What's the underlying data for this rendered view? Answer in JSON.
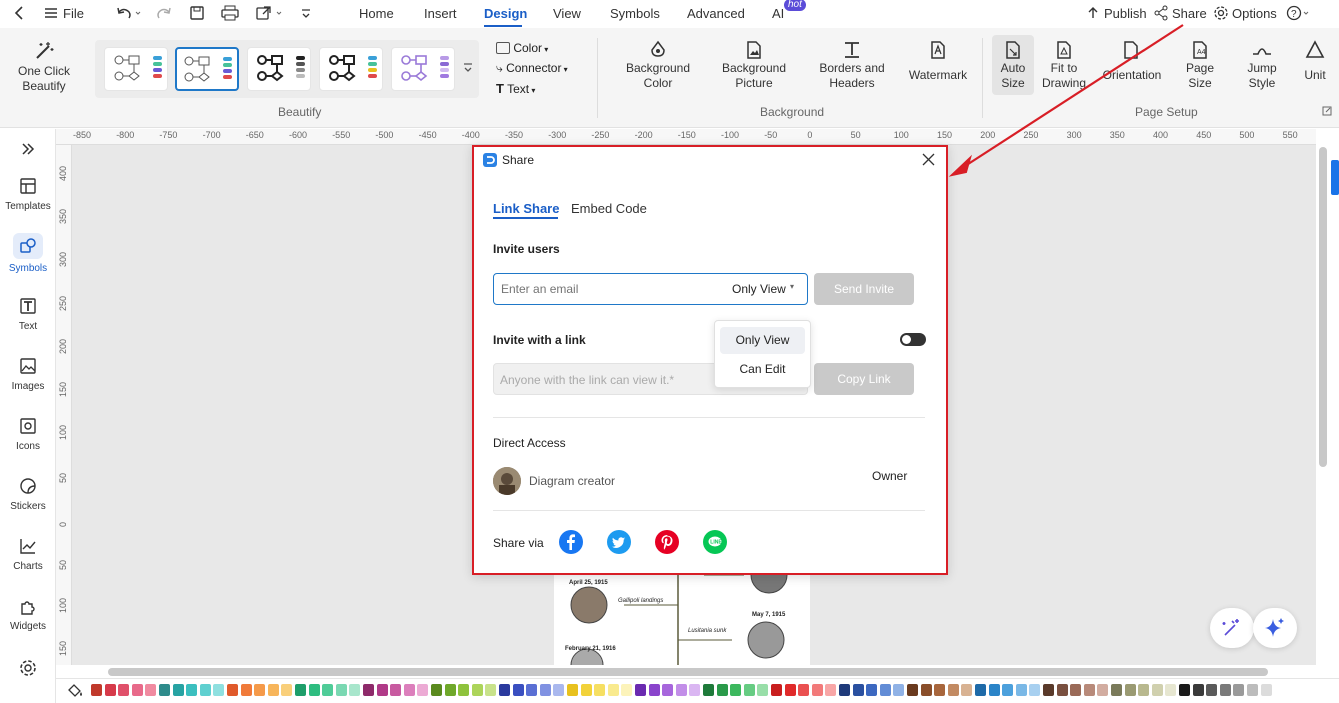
{
  "menubar": {
    "file_label": "File",
    "tabs": [
      "Home",
      "Insert",
      "Design",
      "View",
      "Symbols",
      "Advanced",
      "AI"
    ],
    "active_tab": "Design",
    "hot_badge": "hot",
    "publish_label": "Publish",
    "share_label": "Share",
    "options_label": "Options"
  },
  "ribbon": {
    "one_click_beautify": "One Click Beautify",
    "beautify_group": "Beautify",
    "color_label": "Color",
    "connector_label": "Connector",
    "text_label": "Text",
    "background_color": "Background Color",
    "background_picture": "Background Picture",
    "borders_headers": "Borders and Headers",
    "watermark": "Watermark",
    "background_group": "Background",
    "auto_size": "Auto Size",
    "fit_to_drawing": "Fit to Drawing",
    "orientation": "Orientation",
    "page_size": "Page Size",
    "jump_style": "Jump Style",
    "unit": "Unit",
    "page_setup_group": "Page Setup"
  },
  "sidebar": {
    "items": [
      {
        "label": "Templates",
        "icon": "templates-icon"
      },
      {
        "label": "Symbols",
        "icon": "symbols-icon"
      },
      {
        "label": "Text",
        "icon": "text-icon"
      },
      {
        "label": "Images",
        "icon": "images-icon"
      },
      {
        "label": "Icons",
        "icon": "icons-icon"
      },
      {
        "label": "Stickers",
        "icon": "stickers-icon"
      },
      {
        "label": "Charts",
        "icon": "charts-icon"
      },
      {
        "label": "Widgets",
        "icon": "widgets-icon"
      }
    ],
    "active": "Symbols"
  },
  "ruler": {
    "h_ticks": [
      "-850",
      "-800",
      "-750",
      "-700",
      "-650",
      "-600",
      "-550",
      "-500",
      "-450",
      "-400",
      "-350",
      "-300",
      "-250",
      "-200",
      "-150",
      "-100",
      "-50",
      "0",
      "50",
      "100",
      "150",
      "200",
      "250",
      "300",
      "350",
      "400",
      "450",
      "500",
      "550"
    ],
    "v_ticks": [
      "400",
      "350",
      "300",
      "250",
      "200",
      "150",
      "100",
      "50",
      "0",
      "50",
      "100",
      "150"
    ]
  },
  "share_dialog": {
    "title": "Share",
    "tabs": [
      "Link Share",
      "Embed Code"
    ],
    "active_tab": "Link Share",
    "invite_users_label": "Invite users",
    "email_placeholder": "Enter an email",
    "permission_value": "Only View",
    "send_invite_label": "Send Invite",
    "invite_link_label": "Invite with a link",
    "link_placeholder": "Anyone with the link can view it.*",
    "copy_link_label": "Copy Link",
    "link_toggle_on": false,
    "permission_options": [
      "Only View",
      "Can Edit"
    ],
    "direct_access_label": "Direct Access",
    "user_name": "Diagram creator",
    "user_role": "Owner",
    "share_via_label": "Share via",
    "share_targets": [
      "facebook",
      "twitter",
      "pinterest",
      "line"
    ]
  },
  "diagram_preview": {
    "dates": [
      "April 25, 1915",
      "May 7, 1915",
      "February 21, 1916"
    ],
    "captions": [
      "Gallipoli landings",
      "Lusitania sunk"
    ]
  },
  "colors": {
    "accent": "#1a5ec7",
    "highlight_border": "#d81e26",
    "disabled_button": "#c9c9c9"
  },
  "palette": [
    "#c0392b",
    "#d63a4a",
    "#e0506a",
    "#e86a8a",
    "#f08aa0",
    "#2e8b8b",
    "#27a3a3",
    "#3bbfbf",
    "#5fd0d0",
    "#8fe0e0",
    "#e05a2b",
    "#f07a3a",
    "#f59a4a",
    "#f7b55a",
    "#f9cf7a",
    "#1e9e6a",
    "#2ebd80",
    "#4fcc98",
    "#7ad8b2",
    "#a8e6cc",
    "#8e2a6a",
    "#b03a88",
    "#c85aa0",
    "#dc7fbc",
    "#ecaad4",
    "#5a8a1e",
    "#6fa82a",
    "#8ec23c",
    "#acd45a",
    "#c8e28a",
    "#2a3a9e",
    "#3a4fc0",
    "#5a6fd4",
    "#8092e2",
    "#aab8ee",
    "#e8c11e",
    "#f2d23a",
    "#f6df62",
    "#f9ea8e",
    "#fcf3ba",
    "#6a2ab0",
    "#8a44cc",
    "#a766dc",
    "#c28ee8",
    "#dab6f2",
    "#1e7a3a",
    "#2a9a4a",
    "#3cb85e",
    "#66cc82",
    "#98dea8",
    "#c81e1e",
    "#e02a2a",
    "#ea5050",
    "#f27a7a",
    "#f8a6a6",
    "#1e3a7a",
    "#2a50a0",
    "#3c68c0",
    "#628cd6",
    "#90b2e6",
    "#6a3a1e",
    "#8a4e2a",
    "#a8663c",
    "#c28a62",
    "#d8b292",
    "#1e6aa8",
    "#2a84c8",
    "#4ca0dc",
    "#7ab8e6",
    "#a8d0f0",
    "#5a3a2a",
    "#7a5040",
    "#9a6a58",
    "#b88a7a",
    "#d2aca0",
    "#7a7a5a",
    "#9a9a72",
    "#b8b88e",
    "#d0d0ae",
    "#e6e6d0",
    "#1a1a1a",
    "#3a3a3a",
    "#5a5a5a",
    "#7a7a7a",
    "#9a9a9a",
    "#bcbcbc",
    "#dcdcdc"
  ]
}
